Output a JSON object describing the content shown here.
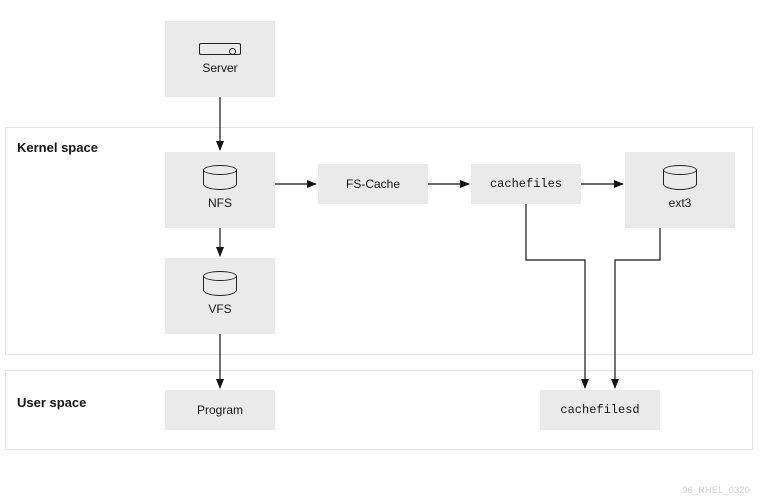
{
  "regions": {
    "kernel": {
      "label": "Kernel space"
    },
    "user": {
      "label": "User space"
    }
  },
  "nodes": {
    "server": {
      "label": "Server"
    },
    "nfs": {
      "label": "NFS"
    },
    "fscache": {
      "label": "FS-Cache"
    },
    "cachefiles": {
      "label": "cachefiles"
    },
    "ext3": {
      "label": "ext3"
    },
    "vfs": {
      "label": "VFS"
    },
    "program": {
      "label": "Program"
    },
    "cachefilesd": {
      "label": "cachefilesd"
    }
  },
  "watermark": "96_RHEL_0320"
}
